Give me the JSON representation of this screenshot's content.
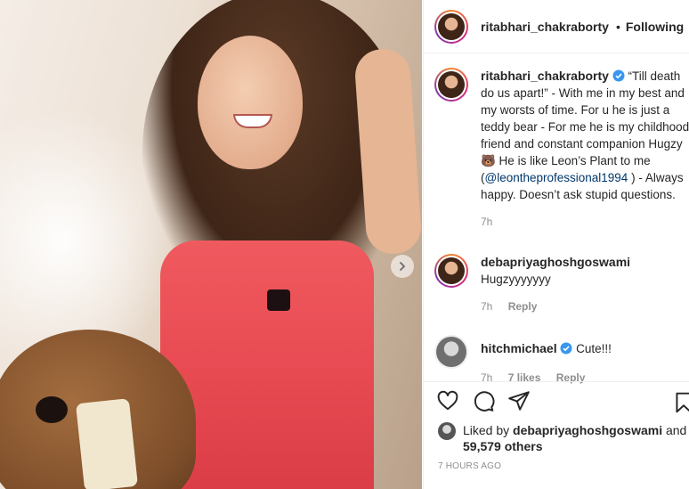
{
  "post": {
    "next_icon": "chevron-right-icon"
  },
  "header": {
    "username": "ritabhari_chakraborty",
    "separator": "•",
    "follow_status": "Following"
  },
  "caption": {
    "username": "ritabhari_chakraborty",
    "text_before_mention": "“Till death do us apart!” - With me in my best and my worsts of time. For u he is just a teddy bear - For me he is my childhood friend and constant companion Hugzy 🐻 He is like Leon’s Plant to me (",
    "mention": "@leontheprofessional1994",
    "text_after_mention": " ) - Always happy. Doesn’t ask stupid questions.",
    "time": "7h"
  },
  "comments": [
    {
      "username": "debapriyaghoshgoswami",
      "text": "Hugzyyyyyyy",
      "time": "7h",
      "reply": "Reply"
    },
    {
      "username": "hitchmichael",
      "text": "Cute!!!",
      "time": "7h",
      "likes": "7 likes",
      "reply": "Reply"
    }
  ],
  "likes": {
    "prefix": "Liked by",
    "user": "debapriyaghoshgoswami",
    "and": "and",
    "count": "59,579 others"
  },
  "posted_ago": "7 HOURS AGO",
  "colors": {
    "link": "#00376b",
    "verified": "#3897f0",
    "muted": "#8e8e8e"
  }
}
